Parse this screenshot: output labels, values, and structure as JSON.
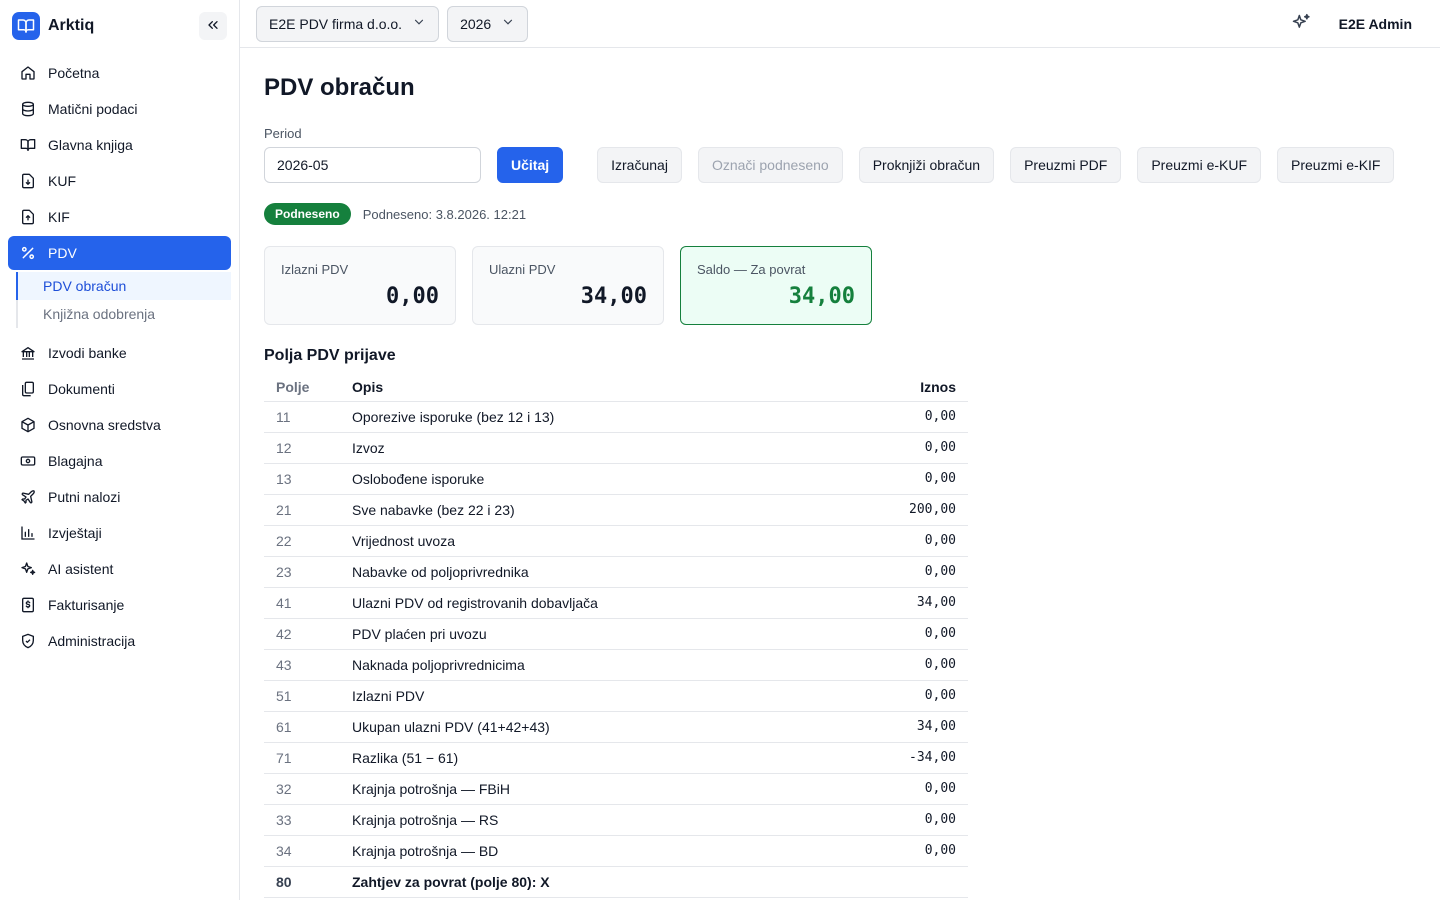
{
  "brand": {
    "name": "Arktiq",
    "color": "#2563eb"
  },
  "sidebar": {
    "items": [
      {
        "label": "Početna",
        "icon": "home-icon"
      },
      {
        "label": "Matični podaci",
        "icon": "database-icon"
      },
      {
        "label": "Glavna knjiga",
        "icon": "book-icon"
      },
      {
        "label": "KUF",
        "icon": "file-in-icon"
      },
      {
        "label": "KIF",
        "icon": "file-out-icon"
      },
      {
        "label": "PDV",
        "icon": "percent-icon",
        "active": true
      }
    ],
    "subitems": [
      {
        "label": "PDV obračun",
        "active": true
      },
      {
        "label": "Knjižna odobrenja"
      }
    ],
    "items_after": [
      {
        "label": "Izvodi banke",
        "icon": "bank-icon"
      },
      {
        "label": "Dokumenti",
        "icon": "documents-icon"
      },
      {
        "label": "Osnovna sredstva",
        "icon": "box-icon"
      },
      {
        "label": "Blagajna",
        "icon": "cash-icon"
      },
      {
        "label": "Putni nalozi",
        "icon": "plane-icon"
      },
      {
        "label": "Izvještaji",
        "icon": "chart-icon"
      },
      {
        "label": "AI asistent",
        "icon": "sparkle-icon"
      },
      {
        "label": "Fakturisanje",
        "icon": "invoice-icon"
      },
      {
        "label": "Administracija",
        "icon": "shield-icon"
      }
    ]
  },
  "topbar": {
    "company": "E2E PDV firma d.o.o.",
    "year": "2026",
    "user": "E2E Admin"
  },
  "page": {
    "title": "PDV obračun",
    "period_label": "Period",
    "period_value": "2026-05",
    "buttons": {
      "load": "Učitaj",
      "calculate": "Izračunaj",
      "mark_submitted": "Označi podneseno",
      "post": "Proknjiži obračun",
      "download_pdf": "Preuzmi PDF",
      "download_kuf": "Preuzmi e-KUF",
      "download_kif": "Preuzmi e-KIF"
    },
    "status_badge": "Podneseno",
    "status_text": "Podneseno: 3.8.2026. 12:21",
    "cards": [
      {
        "label": "Izlazni PDV",
        "value": "0,00"
      },
      {
        "label": "Ulazni PDV",
        "value": "34,00"
      },
      {
        "label": "Saldo — Za povrat",
        "value": "34,00"
      }
    ],
    "section_title": "Polja PDV prijave",
    "table": {
      "headers": {
        "code": "Polje",
        "desc": "Opis",
        "amount": "Iznos"
      },
      "rows": [
        {
          "code": "11",
          "desc": "Oporezive isporuke (bez 12 i 13)",
          "amount": "0,00"
        },
        {
          "code": "12",
          "desc": "Izvoz",
          "amount": "0,00"
        },
        {
          "code": "13",
          "desc": "Oslobođene isporuke",
          "amount": "0,00"
        },
        {
          "code": "21",
          "desc": "Sve nabavke (bez 22 i 23)",
          "amount": "200,00"
        },
        {
          "code": "22",
          "desc": "Vrijednost uvoza",
          "amount": "0,00"
        },
        {
          "code": "23",
          "desc": "Nabavke od poljoprivrednika",
          "amount": "0,00"
        },
        {
          "code": "41",
          "desc": "Ulazni PDV od registrovanih dobavljača",
          "amount": "34,00"
        },
        {
          "code": "42",
          "desc": "PDV plaćen pri uvozu",
          "amount": "0,00"
        },
        {
          "code": "43",
          "desc": "Naknada poljoprivrednicima",
          "amount": "0,00"
        },
        {
          "code": "51",
          "desc": "Izlazni PDV",
          "amount": "0,00"
        },
        {
          "code": "61",
          "desc": "Ukupan ulazni PDV (41+42+43)",
          "amount": "34,00"
        },
        {
          "code": "71",
          "desc": "Razlika (51 − 61)",
          "amount": "-34,00"
        },
        {
          "code": "32",
          "desc": "Krajnja potrošnja — FBiH",
          "amount": "0,00"
        },
        {
          "code": "33",
          "desc": "Krajnja potrošnja — RS",
          "amount": "0,00"
        },
        {
          "code": "34",
          "desc": "Krajnja potrošnja — BD",
          "amount": "0,00"
        }
      ],
      "total": {
        "code": "80",
        "desc": "Zahtjev za povrat (polje 80): X",
        "amount": ""
      }
    }
  }
}
